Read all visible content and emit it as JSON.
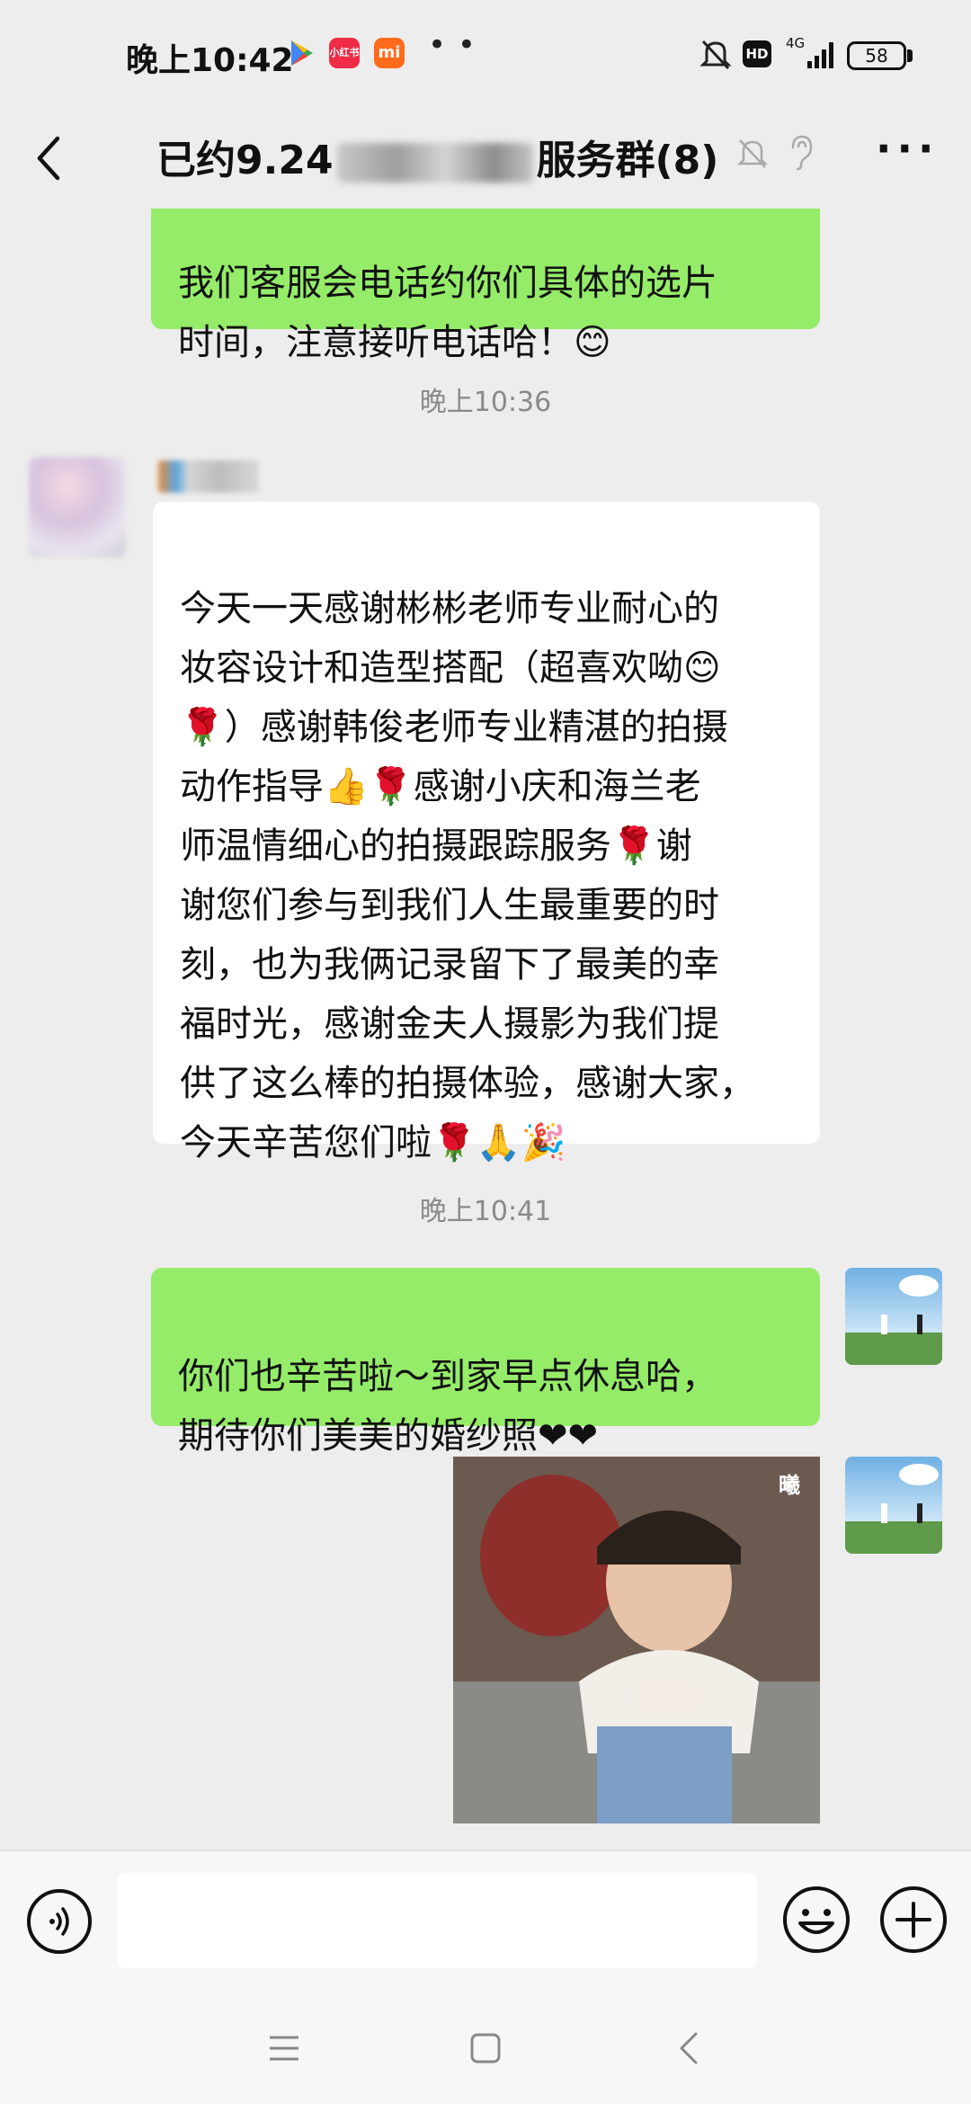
{
  "status_bar": {
    "time": "晚上10:42",
    "redbook_label": "小红书",
    "mi_label": "mi",
    "more": "• •",
    "hd": "HD",
    "network": "4G",
    "battery": "58"
  },
  "header": {
    "title_prefix": "已约9.24",
    "title_suffix": "服务群(8)",
    "icons": [
      "back-icon",
      "mute-icon",
      "ear-icon",
      "more-icon"
    ]
  },
  "messages": [
    {
      "type": "text",
      "side": "me",
      "text": "我们客服会电话约你们具体的选片\n时间，注意接听电话哈！😊"
    },
    {
      "type": "time",
      "text": "晚上10:36"
    },
    {
      "type": "text",
      "side": "other",
      "text": "今天一天感谢彬彬老师专业耐心的\n妆容设计和造型搭配（超喜欢呦😊\n🌹）感谢韩俊老师专业精湛的拍摄\n动作指导👍🌹感谢小庆和海兰老\n师温情细心的拍摄跟踪服务🌹谢\n谢您们参与到我们人生最重要的时\n刻，也为我俩记录留下了最美的幸\n福时光，感谢金夫人摄影为我们提\n供了这么棒的拍摄体验，感谢大家，\n今天辛苦您们啦🌹🙏🎉"
    },
    {
      "type": "time",
      "text": "晚上10:41"
    },
    {
      "type": "text",
      "side": "me",
      "text": "你们也辛苦啦～到家早点休息哈，\n期待你们美美的婚纱照❤❤"
    },
    {
      "type": "sticker",
      "side": "me",
      "mark": "曦"
    }
  ],
  "input": {
    "value": "",
    "placeholder": ""
  },
  "colors": {
    "background": "#ededed",
    "my_bubble": "#95ec69",
    "other_bubble": "#ffffff"
  }
}
